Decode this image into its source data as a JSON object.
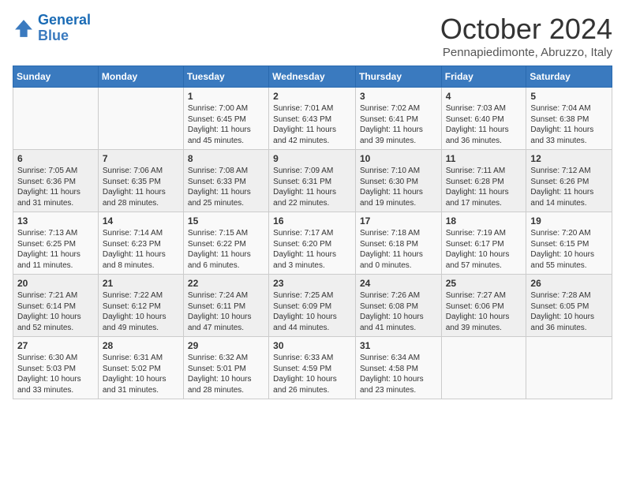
{
  "logo": {
    "line1": "General",
    "line2": "Blue"
  },
  "title": "October 2024",
  "location": "Pennapiedimonte, Abruzzo, Italy",
  "days_of_week": [
    "Sunday",
    "Monday",
    "Tuesday",
    "Wednesday",
    "Thursday",
    "Friday",
    "Saturday"
  ],
  "weeks": [
    [
      {
        "day": "",
        "info": ""
      },
      {
        "day": "",
        "info": ""
      },
      {
        "day": "1",
        "info": "Sunrise: 7:00 AM\nSunset: 6:45 PM\nDaylight: 11 hours and 45 minutes."
      },
      {
        "day": "2",
        "info": "Sunrise: 7:01 AM\nSunset: 6:43 PM\nDaylight: 11 hours and 42 minutes."
      },
      {
        "day": "3",
        "info": "Sunrise: 7:02 AM\nSunset: 6:41 PM\nDaylight: 11 hours and 39 minutes."
      },
      {
        "day": "4",
        "info": "Sunrise: 7:03 AM\nSunset: 6:40 PM\nDaylight: 11 hours and 36 minutes."
      },
      {
        "day": "5",
        "info": "Sunrise: 7:04 AM\nSunset: 6:38 PM\nDaylight: 11 hours and 33 minutes."
      }
    ],
    [
      {
        "day": "6",
        "info": "Sunrise: 7:05 AM\nSunset: 6:36 PM\nDaylight: 11 hours and 31 minutes."
      },
      {
        "day": "7",
        "info": "Sunrise: 7:06 AM\nSunset: 6:35 PM\nDaylight: 11 hours and 28 minutes."
      },
      {
        "day": "8",
        "info": "Sunrise: 7:08 AM\nSunset: 6:33 PM\nDaylight: 11 hours and 25 minutes."
      },
      {
        "day": "9",
        "info": "Sunrise: 7:09 AM\nSunset: 6:31 PM\nDaylight: 11 hours and 22 minutes."
      },
      {
        "day": "10",
        "info": "Sunrise: 7:10 AM\nSunset: 6:30 PM\nDaylight: 11 hours and 19 minutes."
      },
      {
        "day": "11",
        "info": "Sunrise: 7:11 AM\nSunset: 6:28 PM\nDaylight: 11 hours and 17 minutes."
      },
      {
        "day": "12",
        "info": "Sunrise: 7:12 AM\nSunset: 6:26 PM\nDaylight: 11 hours and 14 minutes."
      }
    ],
    [
      {
        "day": "13",
        "info": "Sunrise: 7:13 AM\nSunset: 6:25 PM\nDaylight: 11 hours and 11 minutes."
      },
      {
        "day": "14",
        "info": "Sunrise: 7:14 AM\nSunset: 6:23 PM\nDaylight: 11 hours and 8 minutes."
      },
      {
        "day": "15",
        "info": "Sunrise: 7:15 AM\nSunset: 6:22 PM\nDaylight: 11 hours and 6 minutes."
      },
      {
        "day": "16",
        "info": "Sunrise: 7:17 AM\nSunset: 6:20 PM\nDaylight: 11 hours and 3 minutes."
      },
      {
        "day": "17",
        "info": "Sunrise: 7:18 AM\nSunset: 6:18 PM\nDaylight: 11 hours and 0 minutes."
      },
      {
        "day": "18",
        "info": "Sunrise: 7:19 AM\nSunset: 6:17 PM\nDaylight: 10 hours and 57 minutes."
      },
      {
        "day": "19",
        "info": "Sunrise: 7:20 AM\nSunset: 6:15 PM\nDaylight: 10 hours and 55 minutes."
      }
    ],
    [
      {
        "day": "20",
        "info": "Sunrise: 7:21 AM\nSunset: 6:14 PM\nDaylight: 10 hours and 52 minutes."
      },
      {
        "day": "21",
        "info": "Sunrise: 7:22 AM\nSunset: 6:12 PM\nDaylight: 10 hours and 49 minutes."
      },
      {
        "day": "22",
        "info": "Sunrise: 7:24 AM\nSunset: 6:11 PM\nDaylight: 10 hours and 47 minutes."
      },
      {
        "day": "23",
        "info": "Sunrise: 7:25 AM\nSunset: 6:09 PM\nDaylight: 10 hours and 44 minutes."
      },
      {
        "day": "24",
        "info": "Sunrise: 7:26 AM\nSunset: 6:08 PM\nDaylight: 10 hours and 41 minutes."
      },
      {
        "day": "25",
        "info": "Sunrise: 7:27 AM\nSunset: 6:06 PM\nDaylight: 10 hours and 39 minutes."
      },
      {
        "day": "26",
        "info": "Sunrise: 7:28 AM\nSunset: 6:05 PM\nDaylight: 10 hours and 36 minutes."
      }
    ],
    [
      {
        "day": "27",
        "info": "Sunrise: 6:30 AM\nSunset: 5:03 PM\nDaylight: 10 hours and 33 minutes."
      },
      {
        "day": "28",
        "info": "Sunrise: 6:31 AM\nSunset: 5:02 PM\nDaylight: 10 hours and 31 minutes."
      },
      {
        "day": "29",
        "info": "Sunrise: 6:32 AM\nSunset: 5:01 PM\nDaylight: 10 hours and 28 minutes."
      },
      {
        "day": "30",
        "info": "Sunrise: 6:33 AM\nSunset: 4:59 PM\nDaylight: 10 hours and 26 minutes."
      },
      {
        "day": "31",
        "info": "Sunrise: 6:34 AM\nSunset: 4:58 PM\nDaylight: 10 hours and 23 minutes."
      },
      {
        "day": "",
        "info": ""
      },
      {
        "day": "",
        "info": ""
      }
    ]
  ]
}
